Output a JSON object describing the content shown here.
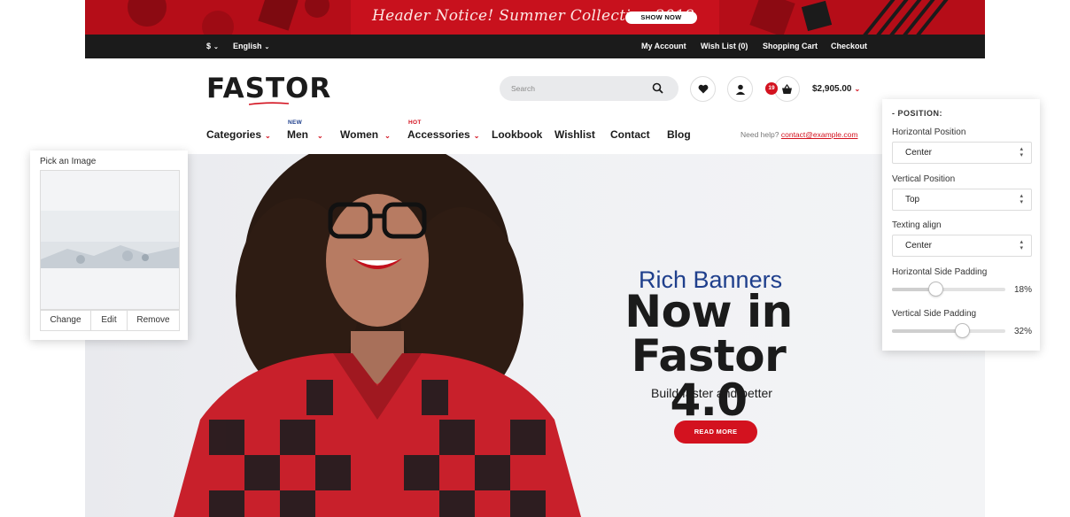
{
  "notice": {
    "text": "Header Notice! Summer Collection 2018",
    "button": "SHOW NOW"
  },
  "topbar": {
    "currency": "$",
    "language": "English",
    "links": [
      "My Account",
      "Wish List (0)",
      "Shopping Cart",
      "Checkout"
    ]
  },
  "header": {
    "logo": "FASTOR",
    "search_placeholder": "Search",
    "cart_count": "19",
    "cart_total": "$2,905.00"
  },
  "nav": {
    "items": [
      {
        "label": "Categories",
        "dropdown": true,
        "tag": ""
      },
      {
        "label": "Men",
        "dropdown": true,
        "tag": "NEW"
      },
      {
        "label": "Women",
        "dropdown": true,
        "tag": ""
      },
      {
        "label": "Accessories",
        "dropdown": true,
        "tag": "HOT"
      },
      {
        "label": "Lookbook",
        "dropdown": false,
        "tag": ""
      },
      {
        "label": "Wishlist",
        "dropdown": false,
        "tag": ""
      },
      {
        "label": "Contact",
        "dropdown": false,
        "tag": ""
      },
      {
        "label": "Blog",
        "dropdown": false,
        "tag": ""
      }
    ],
    "help_label": "Need help?",
    "help_email": "contact@example.com"
  },
  "hero": {
    "subtitle": "Rich Banners",
    "title_line1": "Now in",
    "title_line2": "Fastor 4.0",
    "tagline": "Build faster and better",
    "button": "READ MORE"
  },
  "image_picker": {
    "label": "Pick an Image",
    "actions": [
      "Change",
      "Edit",
      "Remove"
    ]
  },
  "position_panel": {
    "heading": "- POSITION:",
    "horizontal_label": "Horizontal Position",
    "horizontal_value": "Center",
    "vertical_label": "Vertical Position",
    "vertical_value": "Top",
    "text_align_label": "Texting align",
    "text_align_value": "Center",
    "h_padding_label": "Horizontal Side Padding",
    "h_padding_value": "18%",
    "h_padding_fraction": 0.38,
    "v_padding_label": "Vertical Side Padding",
    "v_padding_value": "32%",
    "v_padding_fraction": 0.62
  },
  "colors": {
    "brand_red": "#d3121f",
    "dark": "#1b1b1b",
    "accent_blue": "#1f3f8c"
  }
}
